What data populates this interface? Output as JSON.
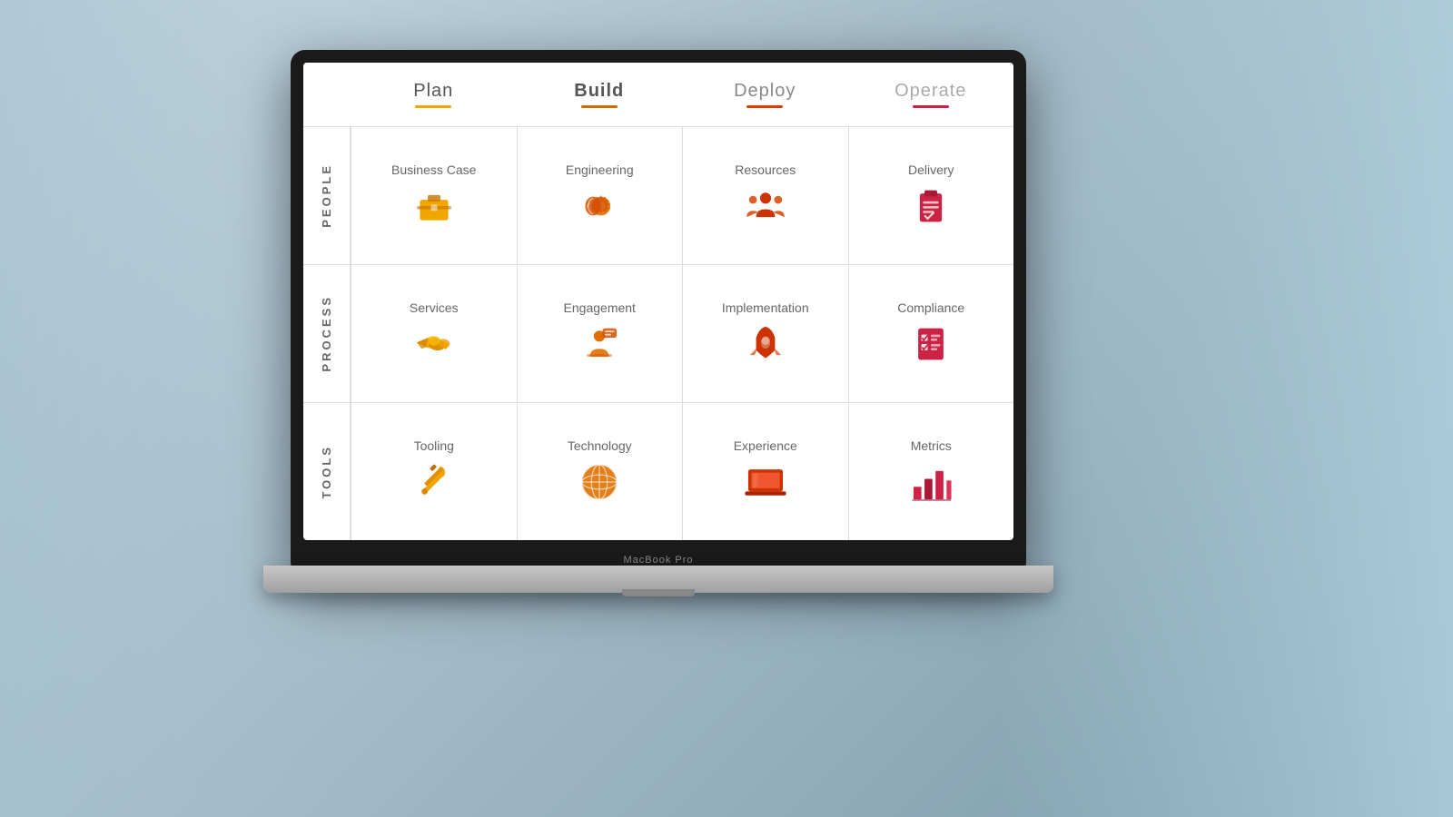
{
  "background": {
    "color": "#b8cdd8"
  },
  "macbook_label": "MacBook Pro",
  "columns": [
    {
      "id": "plan",
      "label": "Plan",
      "underline_color": "#f0a500",
      "font_weight": "400"
    },
    {
      "id": "build",
      "label": "Build",
      "underline_color": "#c87000",
      "font_weight": "700"
    },
    {
      "id": "deploy",
      "label": "Deploy",
      "underline_color": "#d44000",
      "font_weight": "400"
    },
    {
      "id": "operate",
      "label": "Operate",
      "underline_color": "#cc2244",
      "font_weight": "400"
    }
  ],
  "rows": [
    {
      "id": "people",
      "label": "PEOPLE",
      "cells": [
        {
          "title": "Business Case",
          "icon": "briefcase",
          "color": "yellow"
        },
        {
          "title": "Engineering",
          "icon": "gear-brain",
          "color": "orange"
        },
        {
          "title": "Resources",
          "icon": "team",
          "color": "red"
        },
        {
          "title": "Delivery",
          "icon": "clipboard",
          "color": "crimson"
        }
      ]
    },
    {
      "id": "process",
      "label": "PROCESS",
      "cells": [
        {
          "title": "Services",
          "icon": "handshake",
          "color": "yellow"
        },
        {
          "title": "Engagement",
          "icon": "presentation",
          "color": "orange"
        },
        {
          "title": "Implementation",
          "icon": "rocket",
          "color": "red"
        },
        {
          "title": "Compliance",
          "icon": "checklist",
          "color": "crimson"
        }
      ]
    },
    {
      "id": "tools",
      "label": "TOOLS",
      "cells": [
        {
          "title": "Tooling",
          "icon": "wrench",
          "color": "yellow"
        },
        {
          "title": "Technology",
          "icon": "globe",
          "color": "orange"
        },
        {
          "title": "Experience",
          "icon": "laptop",
          "color": "red"
        },
        {
          "title": "Metrics",
          "icon": "barchart",
          "color": "crimson"
        }
      ]
    }
  ]
}
